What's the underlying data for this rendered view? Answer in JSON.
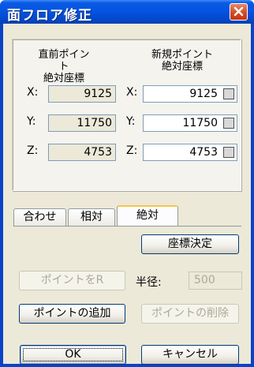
{
  "window": {
    "title": "面フロア修正",
    "close_glyph": "✕"
  },
  "coords": {
    "prev_header": [
      "直前ポイント",
      "絶対座標"
    ],
    "new_header": [
      "新規ポイント",
      "絶対座標"
    ],
    "rows": [
      {
        "label": "X:",
        "prev": "9125",
        "new": "9125"
      },
      {
        "label": "Y:",
        "prev": "11750",
        "new": "11750"
      },
      {
        "label": "Z:",
        "prev": "4753",
        "new": "4753"
      }
    ]
  },
  "tabs": [
    "合わせ",
    "相対",
    "絶対"
  ],
  "active_tab": "絶対",
  "buttons": {
    "decide_coords": "座標決定",
    "point_r": "ポイントをR",
    "radius_label": "半径:",
    "radius_value": "500",
    "add_point": "ポイントの追加",
    "delete_point": "ポイントの削除",
    "ok": "OK",
    "cancel": "キャンセル"
  }
}
